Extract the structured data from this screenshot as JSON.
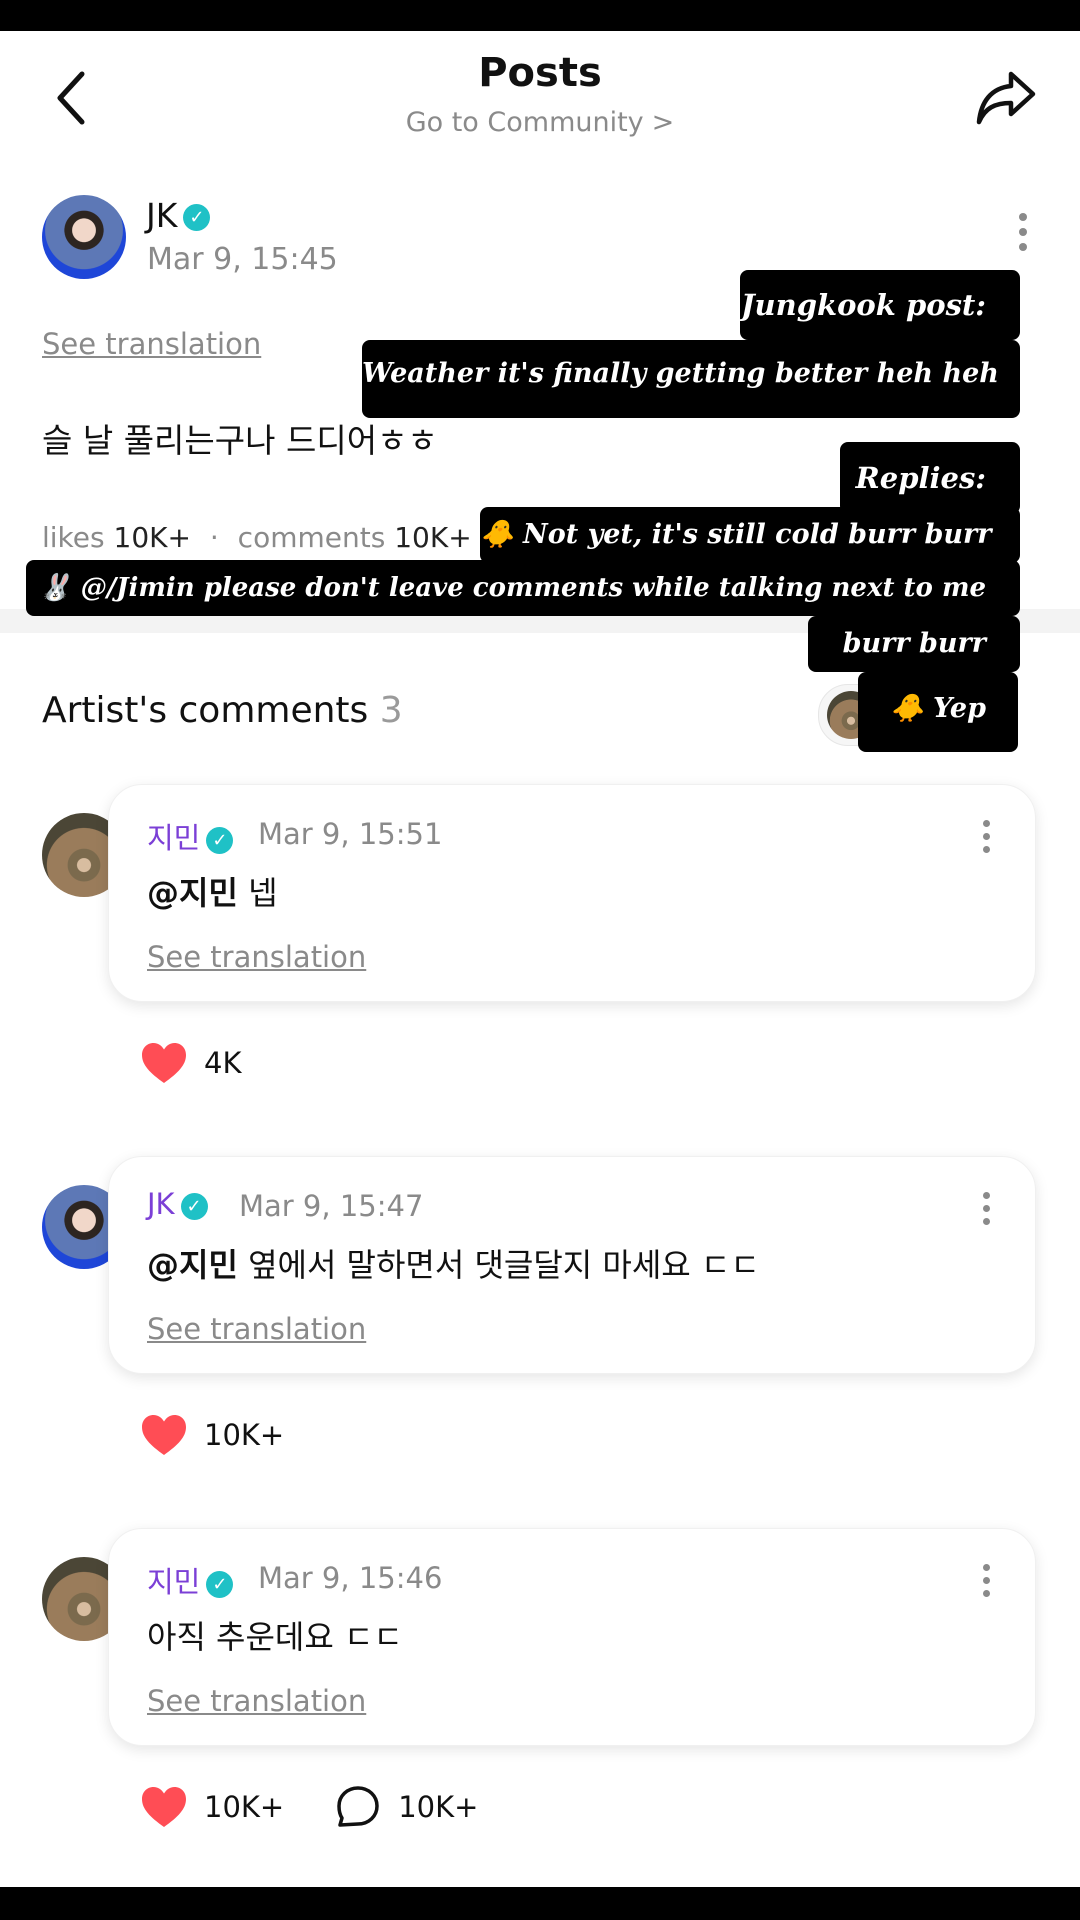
{
  "header": {
    "title": "Posts",
    "subtitle": "Go to Community",
    "subtitle_chevron": ">"
  },
  "post": {
    "author": "JK",
    "verified_mark": "✓",
    "timestamp": "Mar 9, 15:45",
    "see_translation": "See translation",
    "body": "슬 날 풀리는구나 드디어ㅎㅎ",
    "likes_label": "likes",
    "likes_value": "10K+",
    "comments_label": "comments",
    "comments_value": "10K+",
    "separator": "·"
  },
  "artist_comments": {
    "title": "Artist's comments",
    "count": "3"
  },
  "comments": [
    {
      "author": "지민",
      "timestamp": "Mar 9, 15:51",
      "mention": "@지민",
      "text": " 넵",
      "see_translation": "See translation",
      "likes": "4K"
    },
    {
      "author": "JK",
      "timestamp": "Mar 9, 15:47",
      "mention": "@지민",
      "text": " 옆에서 말하면서 댓글달지 마세요 ㄷㄷ",
      "see_translation": "See translation",
      "likes": "10K+"
    },
    {
      "author": "지민",
      "timestamp": "Mar 9, 15:46",
      "mention": "",
      "text": "아직 추운데요 ㄷㄷ",
      "see_translation": "See translation",
      "likes": "10K+",
      "replies": "10K+"
    }
  ],
  "captions": {
    "post_label": "Jungkook post:",
    "post_translation": "Weather it's finally getting better heh heh",
    "replies_label": "Replies:",
    "reply_1": "🐥 Not yet, it's still cold burr burr",
    "reply_2": "🐰 @/Jimin please don't leave comments while talking next to me",
    "reply_2b": "burr burr",
    "reply_3": "🐥 Yep"
  },
  "icons": {
    "back": "chevron-left-icon",
    "share": "share-icon",
    "more": "more-vertical-icon",
    "heart": "heart-icon",
    "reply": "comment-bubble-icon"
  },
  "colors": {
    "accent_name": "#7b3fd6",
    "verified": "#1fc1c6",
    "heart": "#ff4d55",
    "muted": "#8a8a8a"
  }
}
